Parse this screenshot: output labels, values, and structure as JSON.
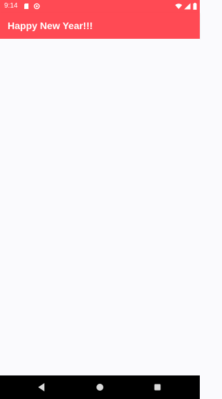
{
  "status_bar": {
    "time": "9:14",
    "left_icons": [
      "sd-card-icon",
      "sync-icon"
    ],
    "right_icons": [
      "wifi-icon",
      "signal-icon",
      "battery-icon"
    ]
  },
  "app_bar": {
    "title": "Happy New Year!!!",
    "color": "#ff4a54"
  },
  "content": {
    "background": "#fafafd"
  },
  "nav_bar": {
    "buttons": [
      "back-icon",
      "home-icon",
      "recents-icon"
    ]
  }
}
